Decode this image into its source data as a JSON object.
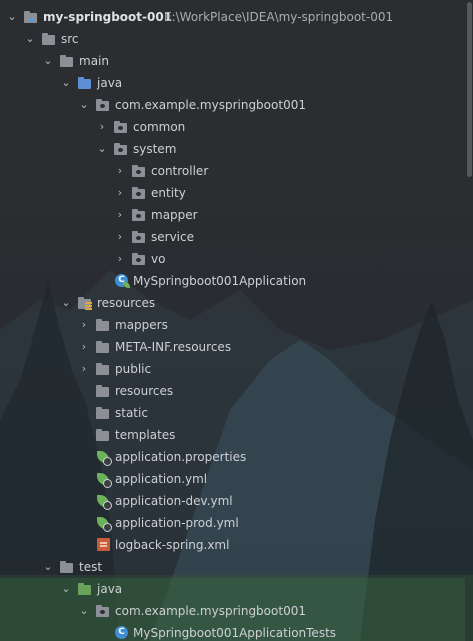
{
  "project": {
    "name": "my-springboot-001",
    "path": "E:\\WorkPlace\\IDEA\\my-springboot-001"
  },
  "tree": {
    "src": "src",
    "main": "main",
    "java": "java",
    "package": "com.example.myspringboot001",
    "common": "common",
    "system": "system",
    "controller": "controller",
    "entity": "entity",
    "mapper": "mapper",
    "service": "service",
    "vo": "vo",
    "app_class": "MySpringboot001Application",
    "resources": "resources",
    "mappers": "mappers",
    "meta_inf": "META-INF.resources",
    "public": "public",
    "resources_sub": "resources",
    "static": "static",
    "templates": "templates",
    "app_props": "application.properties",
    "app_yml": "application.yml",
    "app_dev_yml": "application-dev.yml",
    "app_prod_yml": "application-prod.yml",
    "logback": "logback-spring.xml",
    "test": "test",
    "test_java": "java",
    "test_package": "com.example.myspringboot001",
    "test_class": "MySpringboot001ApplicationTests"
  },
  "icons": {
    "expanded": "chevron-down-icon",
    "collapsed": "chevron-right-icon",
    "folder": "folder-icon",
    "source-root": "blue-folder-icon",
    "test-root": "green-folder-icon",
    "package": "package-icon",
    "resources-root": "resources-folder-icon",
    "spring-config": "spring-config-icon",
    "xml": "xml-file-icon",
    "class": "class-icon"
  },
  "colors": {
    "background": "#2b2d30",
    "text": "#cdd0d5",
    "source_folder": "#5d8fd6",
    "test_folder": "#6aa45a",
    "spring_leaf": "#6bb259",
    "class_icon": "#3f8dd4",
    "xml_icon": "#c75d3b"
  }
}
